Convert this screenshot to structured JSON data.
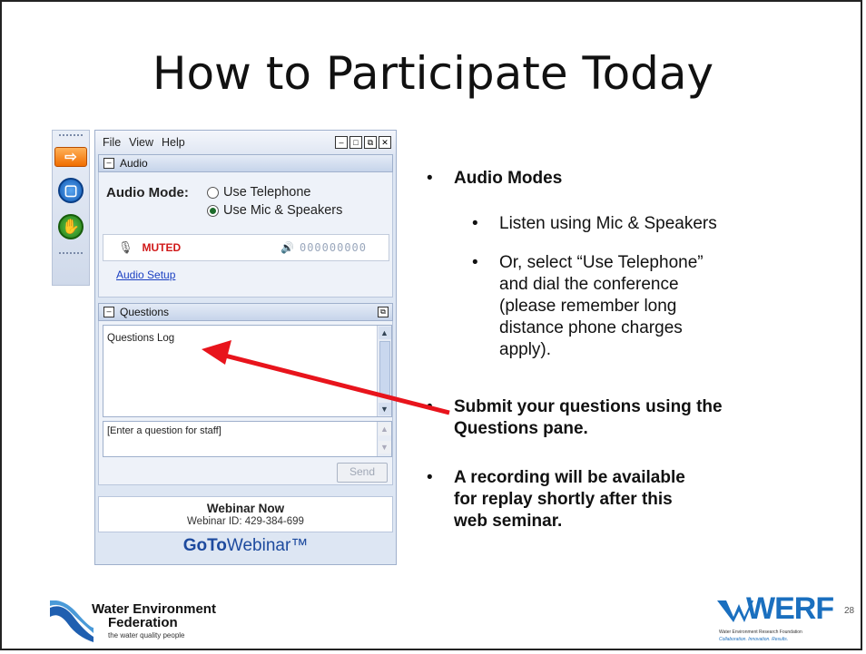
{
  "slide": {
    "title": "How to Participate Today",
    "page_number": "28"
  },
  "panel": {
    "menu": [
      "File",
      "View",
      "Help"
    ],
    "audio_section": "Audio",
    "audio_mode_label": "Audio Mode:",
    "option_telephone": "Use Telephone",
    "option_mic": "Use Mic & Speakers",
    "selected_option": "Use Mic & Speakers",
    "muted_label": "MUTED",
    "meter": "000000000",
    "audio_setup": "Audio Setup",
    "questions_section": "Questions",
    "questions_log": "Questions Log",
    "question_placeholder": "[Enter a question for staff]",
    "send": "Send",
    "webinar_name": "Webinar Now",
    "webinar_id": "Webinar ID: 429-384-699",
    "brand_bold": "GoTo",
    "brand_rest": "Webinar™"
  },
  "bullets": {
    "audio_modes": "Audio Modes",
    "sub1": "Listen using Mic & Speakers",
    "sub2_l1": "Or, select “Use Telephone”",
    "sub2_l2": "and dial the conference",
    "sub2_l3": "(please remember long",
    "sub2_l4": "distance phone charges",
    "sub2_l5": "apply).",
    "q_l1": "Submit your questions using the",
    "q_l2": "Questions pane.",
    "r_l1": "A recording will be available",
    "r_l2": "for replay shortly after this",
    "r_l3": "web seminar."
  },
  "logos": {
    "wef_l1": "Water Environment",
    "wef_l2": "Federation",
    "wef_tagline": "the water quality people",
    "werf": "WERF",
    "werf_tag1": "Water Environment Research Foundation",
    "werf_tag2": "Collaboration. Innovation. Results."
  },
  "colors": {
    "arrow": "#e8141c",
    "muted": "#d01818",
    "brand_blue": "#1d4a9e"
  }
}
